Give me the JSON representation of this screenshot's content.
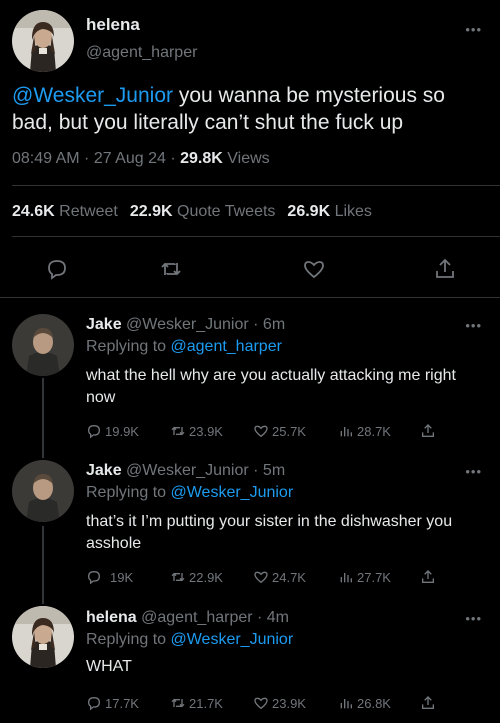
{
  "main_tweet": {
    "display_name": "helena",
    "handle": "@agent_harper",
    "mention": "@Wesker_Junior",
    "text": " you wanna be mysterious so bad, but you literally can’t shut the fuck up",
    "time": "08:49 AM · 27 Aug 24 · ",
    "views_count": "29.8K",
    "views_label": " Views",
    "retweets_count": "24.6K",
    "retweets_label": " Retweet",
    "quotes_count": "22.9K",
    "quotes_label": " Quote Tweets",
    "likes_count": "26.9K",
    "likes_label": " Likes"
  },
  "replies": [
    {
      "display_name": "Jake",
      "handle_time": " @Wesker_Junior · 6m",
      "replying_prefix": "Replying to ",
      "replying_to": "@agent_harper",
      "text": "what the hell why are you actually attacking me right now",
      "replies": "19.9K",
      "retweets": "23.9K",
      "likes": "25.7K",
      "views": "28.7K"
    },
    {
      "display_name": "Jake",
      "handle_time": " @Wesker_Junior · 5m",
      "replying_prefix": "Replying to ",
      "replying_to": "@Wesker_Junior",
      "text": "that’s it I’m putting your sister in the dishwasher you asshole",
      "replies": "19K",
      "retweets": "22.9K",
      "likes": "24.7K",
      "views": "27.7K"
    },
    {
      "display_name": "helena",
      "handle_time": " @agent_harper · 4m",
      "replying_prefix": "Replying to ",
      "replying_to": "@Wesker_Junior",
      "text": "WHAT",
      "replies": "17.7K",
      "retweets": "21.7K",
      "likes": "23.9K",
      "views": "26.8K"
    }
  ],
  "colors": {
    "background": "#000000",
    "text": "#e7e9ea",
    "muted": "#71767b",
    "link": "#1d9bf0",
    "divider": "#2f3336"
  },
  "icons": [
    "more-icon",
    "reply-icon",
    "retweet-icon",
    "like-icon",
    "share-icon",
    "views-icon"
  ]
}
